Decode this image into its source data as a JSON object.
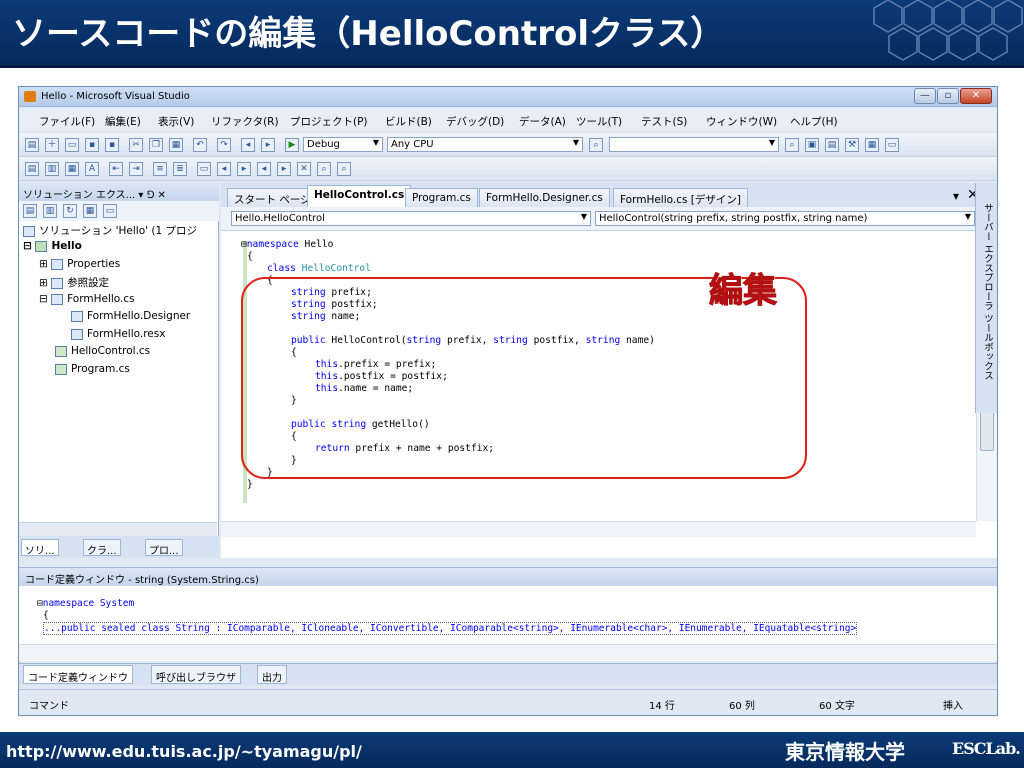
{
  "slide": {
    "title": "ソースコードの編集（HelloControlクラス）",
    "footer_url": "http://www.edu.tuis.ac.jp/~tyamagu/pl/",
    "footer_univ": "東京情報大学",
    "footer_lab": "ESCLab."
  },
  "window": {
    "title": "Hello - Microsoft Visual Studio"
  },
  "menu": [
    "ファイル(F)",
    "編集(E)",
    "表示(V)",
    "リファクタ(R)",
    "プロジェクト(P)",
    "ビルド(B)",
    "デバッグ(D)",
    "データ(A)",
    "ツール(T)",
    "テスト(S)",
    "ウィンドウ(W)",
    "ヘルプ(H)"
  ],
  "toolbar": {
    "config": "Debug",
    "platform": "Any CPU"
  },
  "solution_explorer": {
    "header": "ソリューション エクス... ▾ ⅁ ✕",
    "items": [
      "ソリューション 'Hello' (1 プロジ",
      "Hello",
      "Properties",
      "参照設定",
      "FormHello.cs",
      "FormHello.Designer",
      "FormHello.resx",
      "HelloControl.cs",
      "Program.cs"
    ],
    "tabs": [
      "ソリ...",
      "クラ...",
      "プロ..."
    ]
  },
  "editor": {
    "tabs": [
      "スタート ページ",
      "HelloControl.cs",
      "Program.cs",
      "FormHello.Designer.cs",
      "FormHello.cs [デザイン]"
    ],
    "type_combo": "Hello.HelloControl",
    "member_combo": "HelloControl(string prefix, string postfix, string name)",
    "annotation": "編集"
  },
  "right_strip": "サーバー エクスプローラ  ツールボックス",
  "code_definition": {
    "header": "コード定義ウィンドウ - string (System.String.cs)",
    "line1": "namespace System",
    "line2": "{",
    "line3": "...public sealed class String : IComparable, ICloneable, IConvertible, IComparable<string>, IEnumerable<char>, IEnumerable, IEquatable<string>"
  },
  "bottom_tabs": [
    "コード定義ウィンドウ",
    "呼び出しブラウザ",
    "出力"
  ],
  "status": {
    "mode": "コマンド",
    "line": "14 行",
    "col": "60 列",
    "chars": "60 文字",
    "ins": "挿入"
  }
}
